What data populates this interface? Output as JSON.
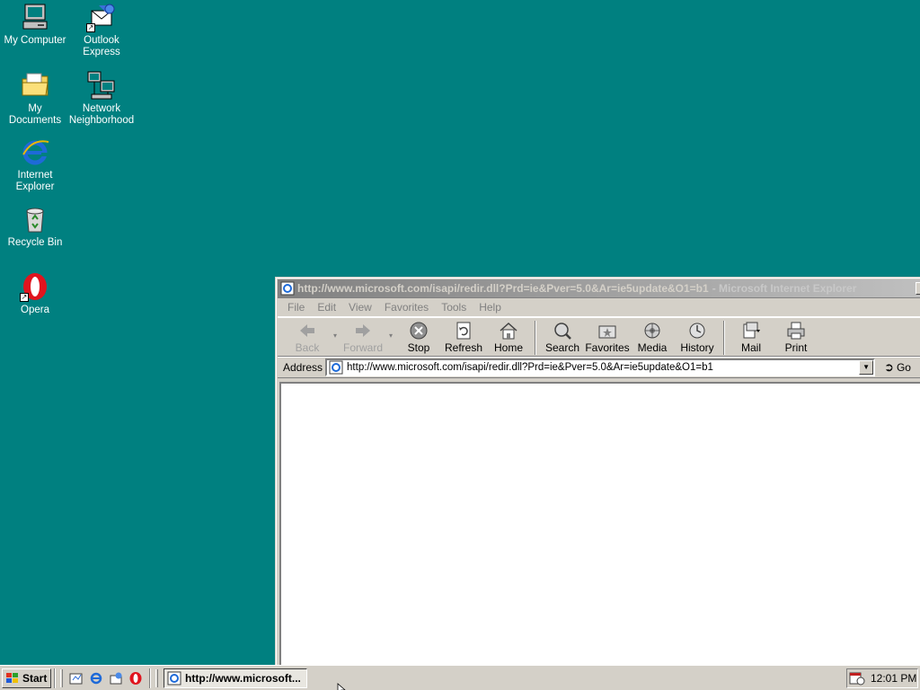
{
  "desktop": {
    "background_color": "#008080",
    "icons": [
      {
        "label": "My Computer",
        "icon": "my-computer-icon"
      },
      {
        "label": "Outlook Express",
        "icon": "outlook-express-icon"
      },
      {
        "label": "My Documents",
        "icon": "my-documents-icon"
      },
      {
        "label": "Network Neighborhood",
        "icon": "network-neighborhood-icon"
      },
      {
        "label": "Internet Explorer",
        "icon": "internet-explorer-icon"
      },
      {
        "label": "Recycle Bin",
        "icon": "recycle-bin-icon"
      },
      {
        "label": "Opera",
        "icon": "opera-icon"
      }
    ]
  },
  "window": {
    "title": "http://www.microsoft.com/isapi/redir.dll?Prd=ie&Pver=5.0&Ar=ie5update&O1=b1",
    "app_name": "- Microsoft Internet Explorer",
    "menu": [
      {
        "label": "File"
      },
      {
        "label": "Edit"
      },
      {
        "label": "View"
      },
      {
        "label": "Favorites"
      },
      {
        "label": "Tools"
      },
      {
        "label": "Help"
      }
    ],
    "toolbar": {
      "back": "Back",
      "forward": "Forward",
      "stop": "Stop",
      "refresh": "Refresh",
      "home": "Home",
      "search": "Search",
      "favorites": "Favorites",
      "media": "Media",
      "history": "History",
      "mail": "Mail",
      "print": "Print"
    },
    "address": {
      "label": "Address",
      "url": "http://www.microsoft.com/isapi/redir.dll?Prd=ie&Pver=5.0&Ar=ie5update&O1=b1",
      "go_label": "Go"
    }
  },
  "taskbar": {
    "start_label": "Start",
    "quick_launch": [
      "show-desktop-icon",
      "internet-explorer-icon",
      "outlook-express-icon",
      "opera-icon"
    ],
    "task_button_label": "http://www.microsoft...",
    "clock": "12:01 PM"
  }
}
